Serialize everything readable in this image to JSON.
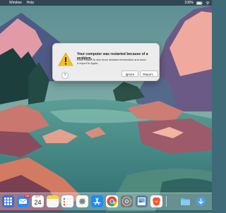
{
  "menubar": {
    "items": [
      "Window",
      "Help"
    ],
    "battery": "100%"
  },
  "dialog": {
    "title": "Your computer was restarted because of a problem.",
    "message": "Click Report to see more detailed information and send a report to Apple.",
    "help_label": "?",
    "ignore_label": "Ignore",
    "report_label": "Report..."
  },
  "dock": {
    "apps": [
      {
        "name": "launchpad-icon",
        "color": "#3c6bd6"
      },
      {
        "name": "mail-icon",
        "color": "#2f8bf0",
        "badge": "164"
      },
      {
        "name": "calendar-icon",
        "color": "#ffffff",
        "month": "SEP",
        "day": "24"
      },
      {
        "name": "notes-icon",
        "color": "#f6d34b"
      },
      {
        "name": "reminders-icon",
        "color": "#ffffff"
      },
      {
        "name": "photos-icon",
        "color": "#ffffff"
      },
      {
        "name": "app-store-icon",
        "color": "#1b8cf6"
      },
      {
        "name": "chrome-icon",
        "color": "#ffffff"
      },
      {
        "name": "system-preferences-icon",
        "color": "#777777"
      },
      {
        "name": "preview-icon",
        "color": "#5a7da6"
      },
      {
        "name": "brave-icon",
        "color": "#ffffff"
      },
      {
        "name": "folder-icon",
        "color": "#67b6ef"
      },
      {
        "name": "downloads-icon",
        "color": "#4c9fe8"
      }
    ]
  }
}
